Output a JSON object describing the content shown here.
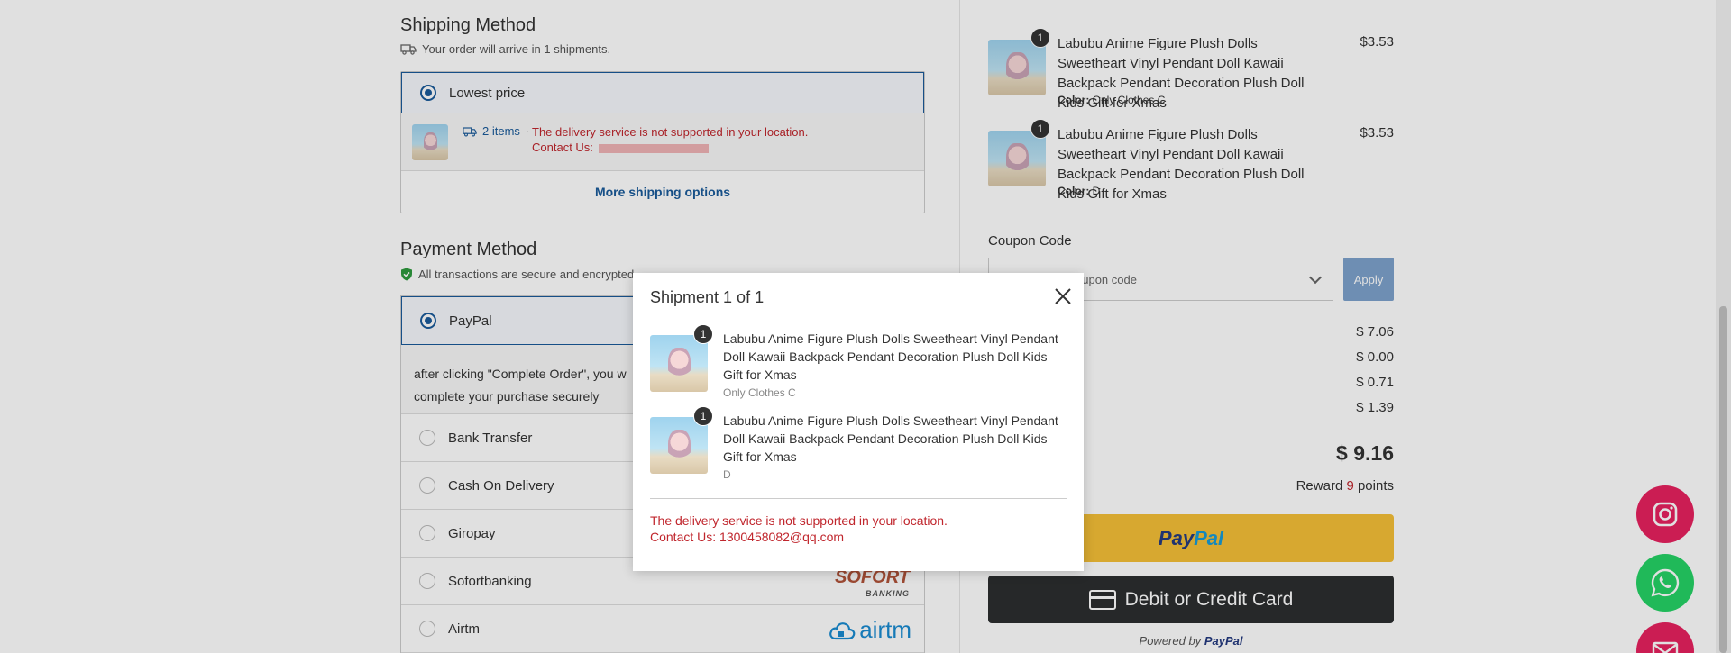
{
  "shipping": {
    "title": "Shipping Method",
    "arrival_note": "Your order will arrive in 1 shipments.",
    "selected_option": "Lowest price",
    "items_count": "2 items",
    "error": "The delivery service is not supported in your location.",
    "contact_label": "Contact Us:",
    "more_options": "More shipping options"
  },
  "payment": {
    "title": "Payment Method",
    "secure_note": "All transactions are secure and encrypted.",
    "selected": "PayPal",
    "note_line1": "after clicking \"Complete Order\", you w",
    "note_line2": "complete your purchase securely",
    "options": [
      "Bank Transfer",
      "Cash On Delivery",
      "Giropay",
      "Sofortbanking",
      "Airtm"
    ],
    "sofort_logo": "SOFORT",
    "sofort_sub": "BANKING",
    "airtm_logo": "airtm"
  },
  "cart": {
    "items": [
      {
        "qty": "1",
        "name": "Labubu Anime Figure Plush Dolls Sweetheart Vinyl Pendant Doll Kawaii Backpack Pendant Decoration Plush Doll Kids Gift for Xmas",
        "color_label": "Color:",
        "color": "Only Clothes C",
        "price": "$3.53"
      },
      {
        "qty": "1",
        "name": "Labubu Anime Figure Plush Dolls Sweetheart Vinyl Pendant Doll Kawaii Backpack Pendant Decoration Plush Doll Kids Gift for Xmas",
        "color_label": "Color:",
        "color": "D",
        "price": "$3.53"
      }
    ]
  },
  "coupon": {
    "label": "Coupon Code",
    "placeholder": "oupon code",
    "apply": "Apply"
  },
  "summary": {
    "values": [
      "$ 7.06",
      "$ 0.00",
      "$ 0.71",
      "$ 1.39"
    ],
    "total": "$ 9.16",
    "reward_prefix": "Reward",
    "reward_points": "9",
    "reward_suffix": "points"
  },
  "buttons": {
    "paypal_pay": "Pay",
    "paypal_pal": "Pal",
    "card": "Debit or Credit Card",
    "powered_prefix": "Powered by",
    "powered_brand": "PayPal"
  },
  "modal": {
    "title": "Shipment 1 of 1",
    "items": [
      {
        "qty": "1",
        "name": "Labubu Anime Figure Plush Dolls Sweetheart Vinyl Pendant Doll Kawaii Backpack Pendant Decoration Plush Doll Kids Gift for Xmas",
        "variant": "Only Clothes C"
      },
      {
        "qty": "1",
        "name": "Labubu Anime Figure Plush Dolls Sweetheart Vinyl Pendant Doll Kawaii Backpack Pendant Decoration Plush Doll Kids Gift for Xmas",
        "variant": "D"
      }
    ],
    "error": "The delivery service is not supported in your location.",
    "contact": "Contact Us: 1300458082@qq.com"
  },
  "colors": {
    "accent": "#1a5b9a",
    "error": "#c0262d",
    "paypal_yellow": "#f5c037",
    "instagram": "#e8215f",
    "whatsapp": "#25d366"
  },
  "icons": [
    "truck-icon",
    "shield-check-icon",
    "close-icon",
    "chevron-down-icon",
    "card-icon",
    "instagram-icon",
    "whatsapp-icon",
    "mail-icon",
    "cloud-icon"
  ]
}
